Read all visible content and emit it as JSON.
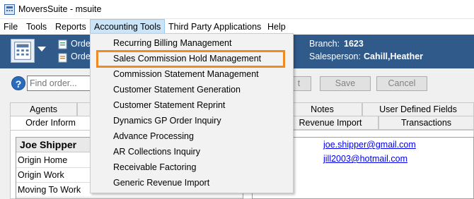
{
  "window": {
    "title": "MoversSuite - msuite"
  },
  "menubar": {
    "items": [
      "File",
      "Tools",
      "Reports",
      "Accounting Tools",
      "Third Party Applications",
      "Help"
    ],
    "active": "Accounting Tools"
  },
  "toolbar": {
    "order_label_1": "Orde",
    "order_label_2": "Orde",
    "branch_label": "Branch:",
    "branch_value": "1623",
    "salesperson_label": "Salesperson:",
    "salesperson_value": "Cahill,Heather"
  },
  "search": {
    "placeholder": "Find order...",
    "button_partial": "t",
    "save_label": "Save",
    "cancel_label": "Cancel"
  },
  "tabs_row1": [
    "Agents",
    "Notes",
    "User Defined Fields"
  ],
  "tabs_row2": [
    "Order Inform",
    "Revenue Import",
    "Transactions"
  ],
  "contact_card": {
    "name": "Joe Shipper",
    "address_rows": [
      "Origin Home",
      "Origin Work",
      "Moving To Work"
    ]
  },
  "contacts": {
    "email_label": "il",
    "emails": [
      "joe.shipper@gmail.com",
      "jill2003@hotmail.com"
    ]
  },
  "accounting_menu": {
    "items": [
      "Recurring Billing Management",
      "Sales Commission Hold Management",
      "Commission Statement Management",
      "Customer Statement Generation",
      "Customer Statement Reprint",
      "Dynamics GP Order Inquiry",
      "Advance Processing",
      "AR Collections Inquiry",
      "Receivable Factoring",
      "Generic Revenue Import"
    ],
    "highlighted": "Sales Commission Hold Management",
    "highlight_color": "#f08a24"
  },
  "colors": {
    "toolbar_bg": "#2f5a8a",
    "menu_active_bg": "#cce4f7",
    "link": "#0000ee"
  }
}
